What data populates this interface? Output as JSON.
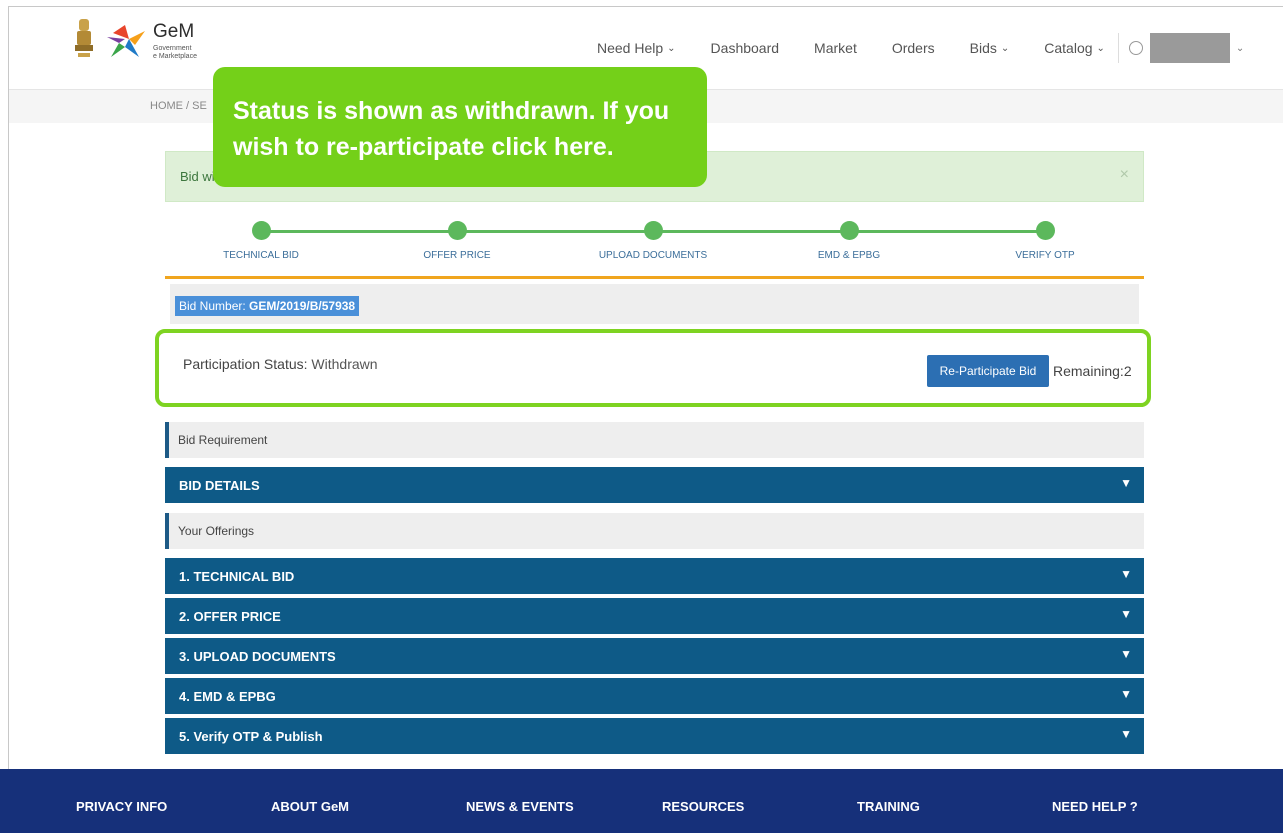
{
  "header": {
    "brand": {
      "name": "GeM",
      "sub1": "Government",
      "sub2": "e Marketplace"
    },
    "nav": [
      {
        "label": "Need Help",
        "dropdown": true
      },
      {
        "label": "Dashboard",
        "dropdown": false
      },
      {
        "label": "Market",
        "dropdown": false
      },
      {
        "label": "Orders",
        "dropdown": false
      },
      {
        "label": "Bids",
        "dropdown": true
      },
      {
        "label": "Catalog",
        "dropdown": true
      }
    ]
  },
  "breadcrumb": {
    "text": "HOME / SE"
  },
  "tooltip": {
    "text": "Status is shown as withdrawn. If you wish to re-participate click here."
  },
  "alert": {
    "message": "Bid wi",
    "close": "×"
  },
  "stepper": {
    "steps": [
      {
        "label": "TECHNICAL BID"
      },
      {
        "label": "OFFER PRICE"
      },
      {
        "label": "UPLOAD DOCUMENTS"
      },
      {
        "label": "EMD & EPBG"
      },
      {
        "label": "VERIFY OTP"
      }
    ],
    "color": "#5cb85c"
  },
  "bid": {
    "number_label": "Bid Number: ",
    "number_value": "GEM/2019/B/57938",
    "status_label": "Participation Status: ",
    "status_value": "Withdrawn",
    "reparticipate_label": "Re-Participate Bid",
    "remaining": "Remaining:2"
  },
  "sections": {
    "requirement_label": "Bid Requirement",
    "bid_details": "BID DETAILS",
    "offerings_label": "Your Offerings",
    "offerings": [
      "1. TECHNICAL BID",
      "2. OFFER PRICE",
      "3. UPLOAD DOCUMENTS",
      "4. EMD & EPBG",
      "5. Verify OTP & Publish"
    ]
  },
  "footer": {
    "columns": [
      "PRIVACY INFO",
      "ABOUT GeM",
      "NEWS & EVENTS",
      "RESOURCES",
      "TRAINING",
      "NEED HELP ?"
    ]
  },
  "colors": {
    "accent": "#0e5a87",
    "highlight": "#7ed321",
    "tooltip": "#74d019",
    "footer": "#16307a"
  }
}
